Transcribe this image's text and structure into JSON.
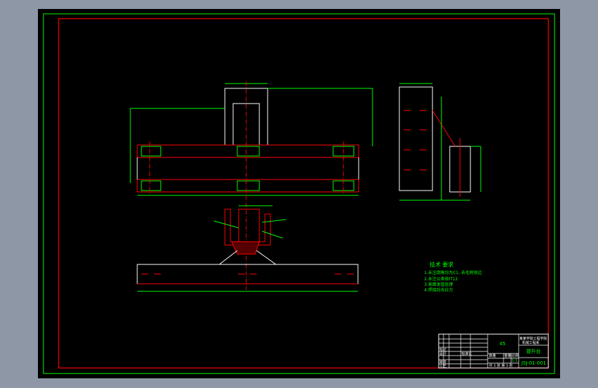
{
  "colors": {
    "frame": "#00ff00",
    "border": "#ff0000",
    "geometry": "#ffffff",
    "dims": "#00ff00",
    "center": "#ff0000"
  },
  "tech_requirements": {
    "title": "技术 要求",
    "items": [
      "1.未注倒角均为C1, 去毛刺锐边",
      "2.未注公差按IT12",
      "3.表面发蓝处理",
      "4.焊接后去应力"
    ]
  },
  "title_block": {
    "material": "45",
    "school_line1": "某某学院工程学院",
    "school_line2": "机械工程系",
    "part_name": "提升台",
    "drawing_no": "JSJ-01-001",
    "scale_label": "比例",
    "weight_label": "重量",
    "qty_label": "数量",
    "scale": "1:1",
    "sheets": "共 1 张 第 1 张",
    "designer": "设计",
    "checker": "审核",
    "approver": "工艺",
    "std": "标准化",
    "row_labels": [
      "标记",
      "处数",
      "分区",
      "签名",
      "日期"
    ]
  }
}
